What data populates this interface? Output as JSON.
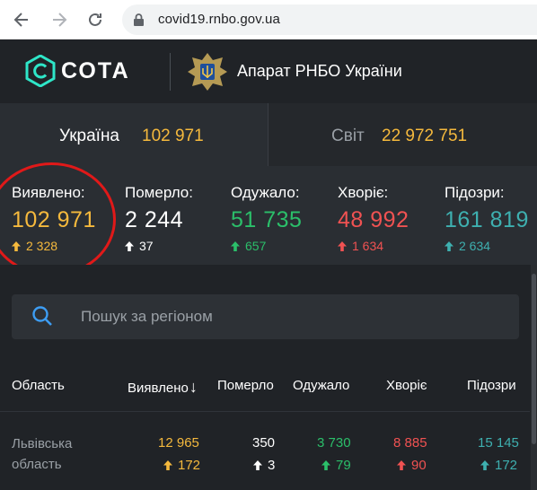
{
  "browser": {
    "url": "covid19.rnbo.gov.ua"
  },
  "header": {
    "logo_text": "СОТА",
    "org_name": "Апарат РНБО України"
  },
  "tabs": [
    {
      "label": "Україна",
      "value": "102 971",
      "active": true
    },
    {
      "label": "Світ",
      "value": "22 972 751",
      "active": false
    }
  ],
  "stats": [
    {
      "label": "Виявлено:",
      "value": "102 971",
      "delta": "2 328",
      "color": "#f5b93d"
    },
    {
      "label": "Померло:",
      "value": "2 244",
      "delta": "37",
      "color": "#ffffff"
    },
    {
      "label": "Одужало:",
      "value": "51 735",
      "delta": "657",
      "color": "#2bbf6a"
    },
    {
      "label": "Хворіє:",
      "value": "48 992",
      "delta": "1 634",
      "color": "#f05252"
    },
    {
      "label": "Підозри:",
      "value": "161 819",
      "delta": "2 634",
      "color": "#3eb0b0"
    }
  ],
  "search": {
    "placeholder": "Пошук за регіоном"
  },
  "table": {
    "columns": [
      "Область",
      "Виявлено",
      "Померло",
      "Одужало",
      "Хворіє",
      "Підозри"
    ],
    "sort_indicator": "↓",
    "rows": [
      {
        "region": [
          "Львівська",
          "область"
        ],
        "detected": "12 965",
        "detected_delta": "172",
        "deaths": "350",
        "deaths_delta": "3",
        "recovered": "3 730",
        "recovered_delta": "79",
        "sick": "8 885",
        "sick_delta": "90",
        "suspected": "15 145",
        "suspected_delta": "172"
      }
    ]
  }
}
